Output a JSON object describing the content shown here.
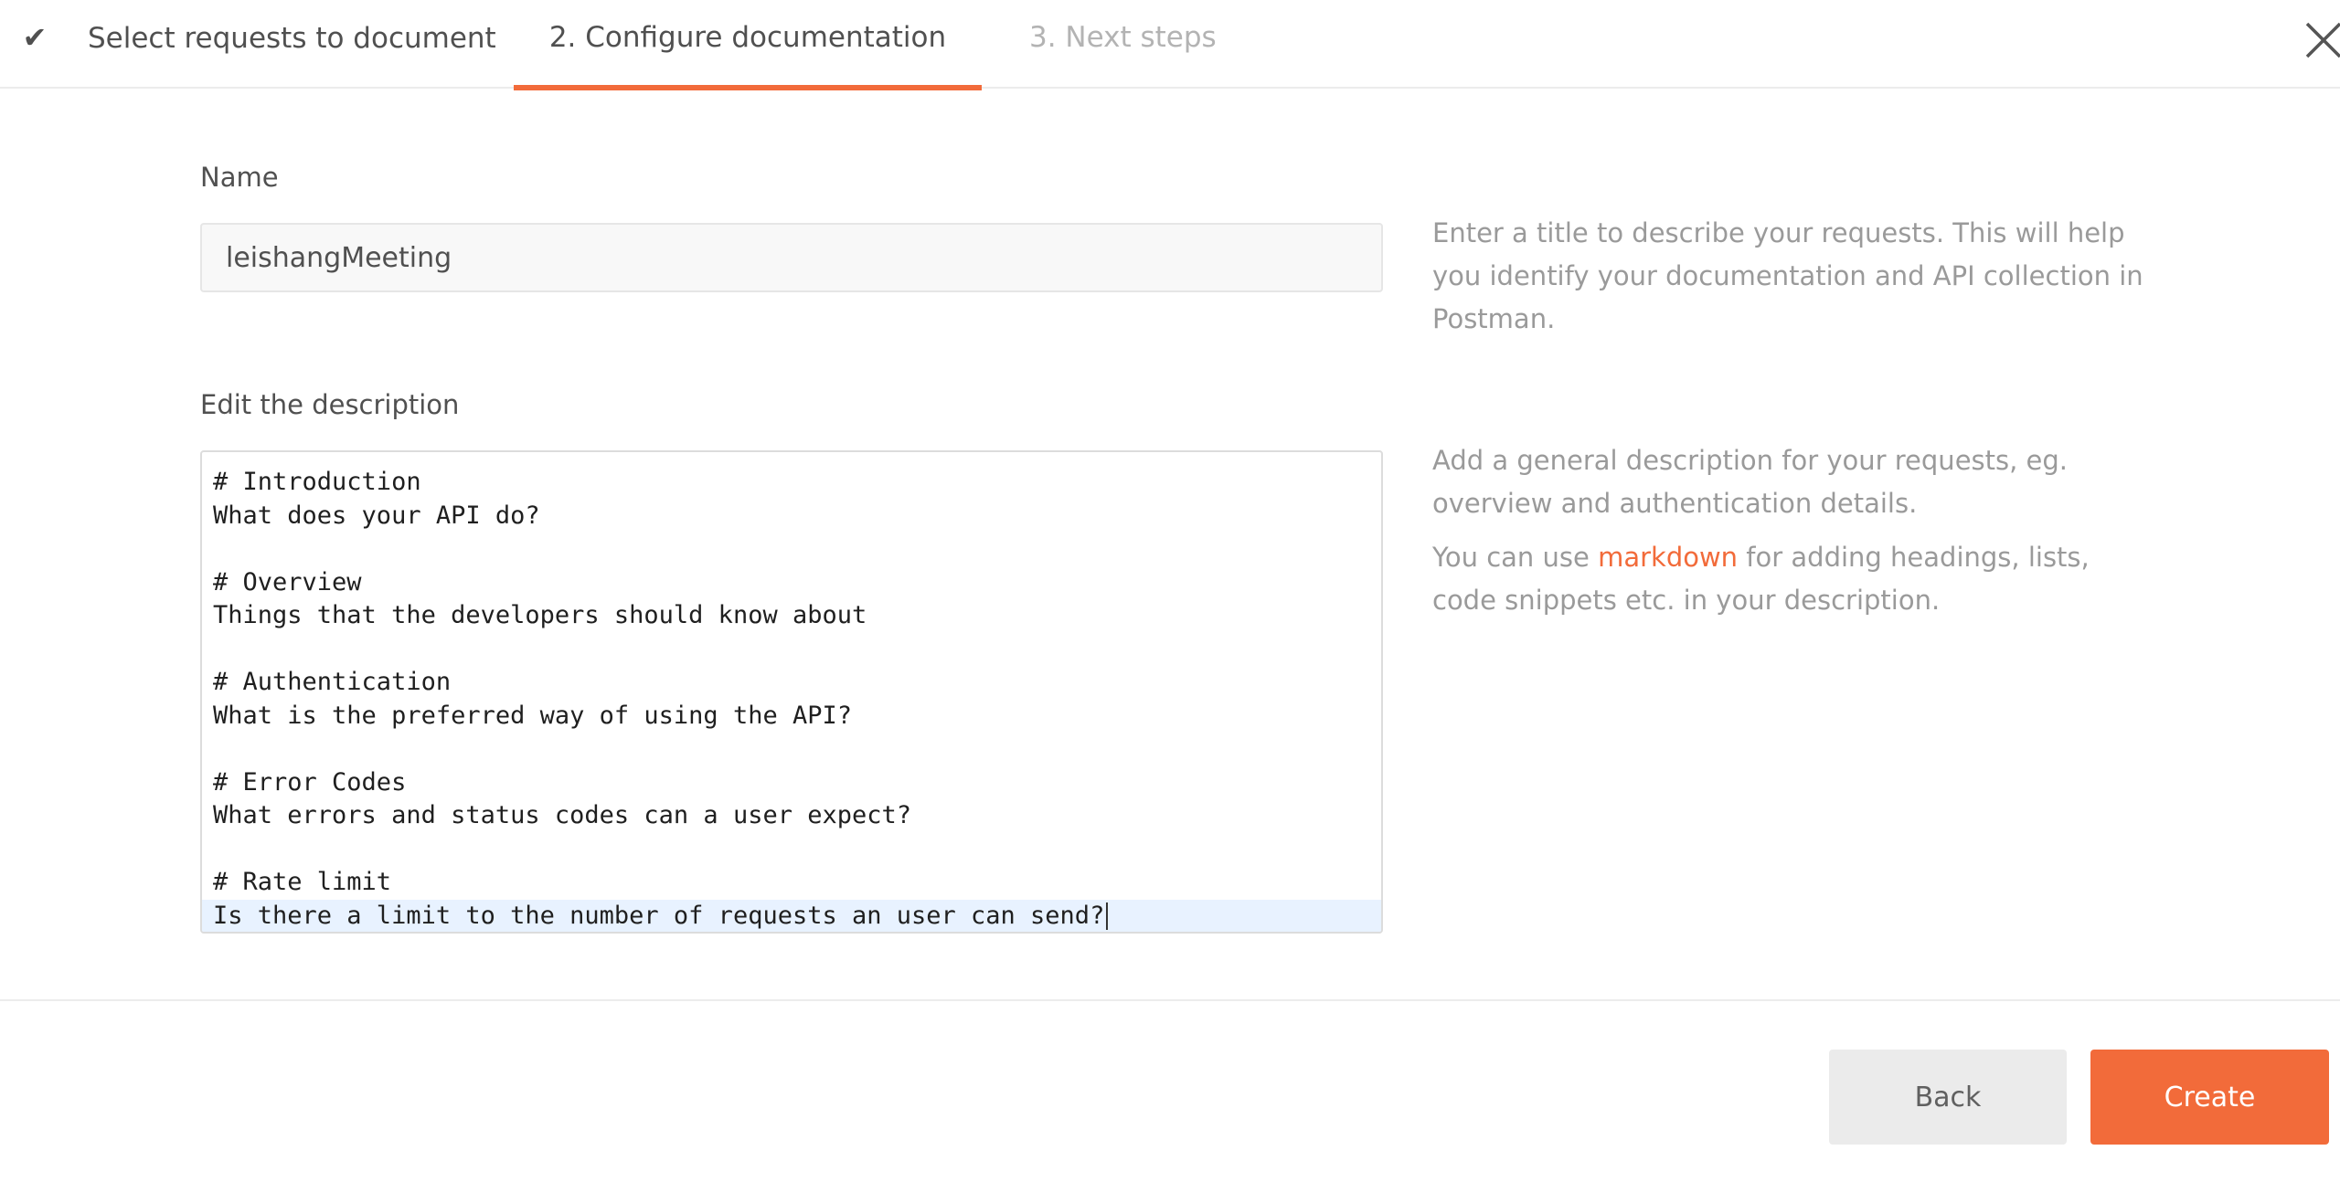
{
  "steps": {
    "step1_label": "Select requests to document",
    "step2_label": "2. Configure documentation",
    "step3_label": "3. Next steps",
    "check_icon": "checkmark-icon",
    "close_icon": "close-icon"
  },
  "form": {
    "name_label": "Name",
    "name_value": "leishangMeeting",
    "name_help": "Enter a title to describe your requests. This will help you identify your documentation and API collection in Postman.",
    "description_label": "Edit the description",
    "description_lines": [
      "# Introduction",
      "What does your API do?",
      "",
      "# Overview",
      "Things that the developers should know about",
      "",
      "# Authentication",
      "What is the preferred way of using the API?",
      "",
      "# Error Codes",
      "What errors and status codes can a user expect?",
      "",
      "# Rate limit",
      "Is there a limit to the number of requests an user can send?"
    ],
    "description_help_1": "Add a general description for your requests, eg. overview and authentication details.",
    "description_help_2_prefix": "You can use ",
    "description_help_2_link": "markdown",
    "description_help_2_suffix": " for adding headings, lists, code snippets etc. in your description."
  },
  "actions": {
    "back_label": "Back",
    "create_label": "Create"
  },
  "colors": {
    "accent": "#f26b3a",
    "active_line": "#e8f2ff"
  }
}
